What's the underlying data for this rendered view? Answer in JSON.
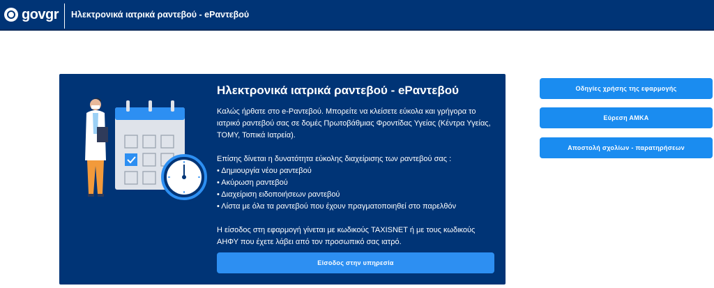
{
  "header": {
    "logo_text": "govgr",
    "app_title": "Ηλεκτρονικά ιατρικά ραντεβού - eΡαντεβού"
  },
  "card": {
    "title": "Ηλεκτρονικά ιατρικά ραντεβού - eΡαντεβού",
    "intro": "Καλώς ήρθατε στο e-Ραντεβού. Μπορείτε να κλείσετε εύκολα και γρήγορα το ιατρικό ραντεβού σας σε δομές Πρωτοβάθμιας Φροντίδας Υγείας (Κέντρα Υγείας, ΤΟΜΥ, Τοπικά Ιατρεία).",
    "features_intro": "Επίσης δίνεται η δυνατότητα εύκολης διαχείρισης των ραντεβού σας :",
    "features": [
      "• Δημιουργία νέου ραντεβού",
      "• Ακύρωση ραντεβού",
      "• Διαχείριση ειδοποιήσεων ραντεβού",
      "• Λίστα με όλα τα ραντεβού που έχουν πραγματοποιηθεί στο παρελθόν"
    ],
    "login_info": "Η είσοδος στη εφαρμογή γίνεται με κωδικούς TAXISNET ή με τους κωδικούς ΑΗΦΥ που έχετε λάβει από τον προσωπικό σας ιατρό.",
    "enter_button": "Είσοδος στην υπηρεσία"
  },
  "sidebar": {
    "buttons": [
      "Οδηγίες χρήσης της εφαρμογής",
      "Εύρεση ΑΜΚΑ",
      "Αποστολή σχολίων - παρατηρήσεων"
    ]
  },
  "colors": {
    "header_bg": "#003476",
    "card_bg": "#003476",
    "button_bg": "#1a8cf0"
  }
}
